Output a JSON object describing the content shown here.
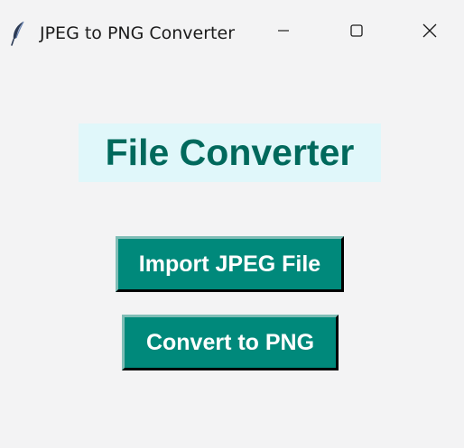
{
  "window": {
    "title": "JPEG to PNG Converter",
    "icon": "feather-icon",
    "controls": [
      "minimize-icon",
      "maximize-icon",
      "close-icon"
    ]
  },
  "main": {
    "heading": "File Converter",
    "import_button_label": "Import JPEG File",
    "convert_button_label": "Convert to PNG"
  },
  "colors": {
    "background": "#f3f3f4",
    "heading_bg": "#e0f7fa",
    "heading_text": "#00695c",
    "button_bg": "#00897b",
    "button_text": "#ffffff"
  }
}
